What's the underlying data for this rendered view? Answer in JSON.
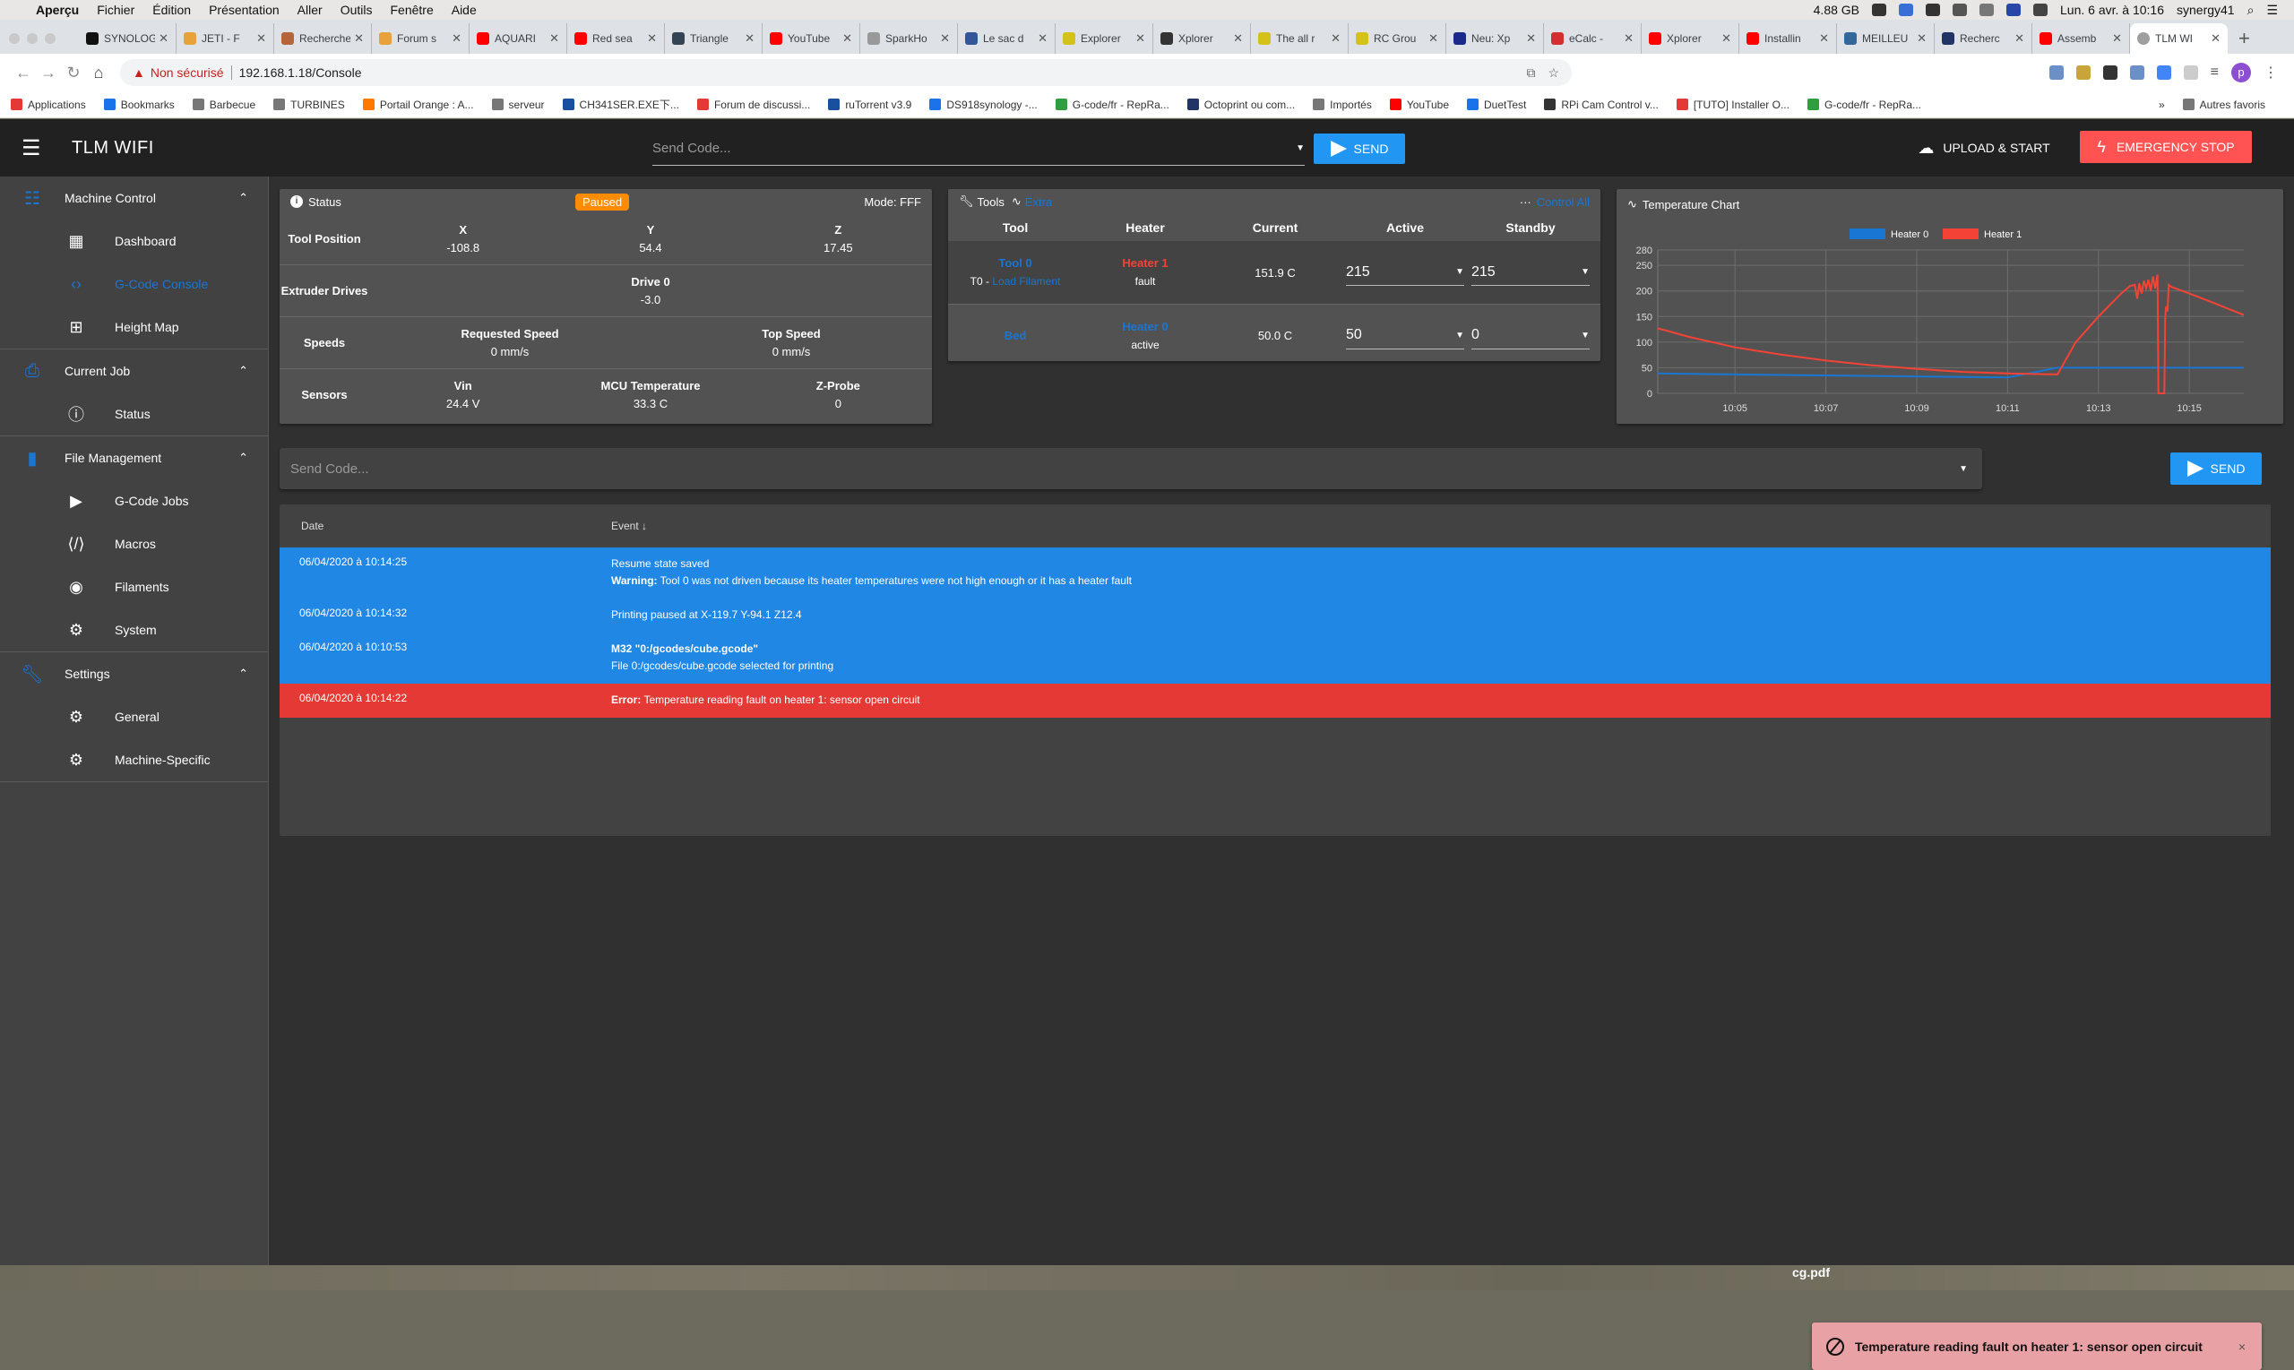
{
  "menubar": {
    "app": "Aperçu",
    "items": [
      "Fichier",
      "Édition",
      "Présentation",
      "Aller",
      "Outils",
      "Fenêtre",
      "Aide"
    ],
    "memory": "4.88 GB",
    "datetime": "Lun. 6 avr. à 10:16",
    "user": "synergy41"
  },
  "browser": {
    "tabs": [
      {
        "title": "SYNOLOGY",
        "color": "#111111"
      },
      {
        "title": "JETI - F",
        "color": "#e8a23a"
      },
      {
        "title": "Recherche",
        "color": "#b5653a"
      },
      {
        "title": "Forum s",
        "color": "#e8a23a"
      },
      {
        "title": "AQUARI",
        "color": "#ff0000"
      },
      {
        "title": "Red sea",
        "color": "#ff0000"
      },
      {
        "title": "Triangle",
        "color": "#334455"
      },
      {
        "title": "YouTube",
        "color": "#ff0000"
      },
      {
        "title": "SparkHo",
        "color": "#999999"
      },
      {
        "title": "Le sac d",
        "color": "#335599"
      },
      {
        "title": "Explorer",
        "color": "#d4c21a"
      },
      {
        "title": "Xplorer",
        "color": "#333333"
      },
      {
        "title": "The all r",
        "color": "#d4c21a"
      },
      {
        "title": "RC Grou",
        "color": "#d4c21a"
      },
      {
        "title": "Neu: Xp",
        "color": "#1a2a8a"
      },
      {
        "title": "eCalc -",
        "color": "#d32f2f"
      },
      {
        "title": "Xplorer",
        "color": "#ff0000"
      },
      {
        "title": "Installin",
        "color": "#ff0000"
      },
      {
        "title": "MEILLEU",
        "color": "#336699"
      },
      {
        "title": "Recherc",
        "color": "#223366"
      },
      {
        "title": "Assemb",
        "color": "#ff0000"
      },
      {
        "title": "TLM WI",
        "color": "#9e9e9e",
        "active": true
      }
    ],
    "new_tab": "+",
    "security_label": "Non sécurisé",
    "url": "192.168.1.18/Console",
    "profile_initial": "p",
    "bookmarks": [
      {
        "label": "Applications",
        "color": "#e53935"
      },
      {
        "label": "Bookmarks",
        "color": "#1a73e8"
      },
      {
        "label": "Barbecue",
        "color": "#777777"
      },
      {
        "label": "TURBINES",
        "color": "#777777"
      },
      {
        "label": "Portail Orange : A...",
        "color": "#ff7900"
      },
      {
        "label": "serveur",
        "color": "#777777"
      },
      {
        "label": "CH341SER.EXE下...",
        "color": "#1a4fa0"
      },
      {
        "label": "Forum de discussi...",
        "color": "#e53935"
      },
      {
        "label": "ruTorrent v3.9",
        "color": "#1a4fa0"
      },
      {
        "label": "DS918synology -...",
        "color": "#1a73e8"
      },
      {
        "label": "G-code/fr - RepRa...",
        "color": "#2e9e3e"
      },
      {
        "label": "Octoprint ou com...",
        "color": "#223366"
      },
      {
        "label": "Importés",
        "color": "#777777"
      },
      {
        "label": "YouTube",
        "color": "#ff0000"
      },
      {
        "label": "DuetTest",
        "color": "#1a73e8"
      },
      {
        "label": "RPi Cam Control v...",
        "color": "#333333"
      },
      {
        "label": "[TUTO] Installer O...",
        "color": "#e53935"
      },
      {
        "label": "G-code/fr - RepRa...",
        "color": "#2e9e3e"
      }
    ],
    "more_bookmarks": "»",
    "other_bookmarks": "Autres favoris"
  },
  "app": {
    "title": "TLM WIFI",
    "top_code_placeholder": "Send Code...",
    "send_label": "SEND",
    "upload_label": "UPLOAD & START",
    "estop_label": "EMERGENCY STOP",
    "colors": {
      "accent": "#2196f3",
      "primary": "#1976d2",
      "danger": "#ff5252",
      "paused": "#ff8c00"
    }
  },
  "sidebar": {
    "groups": [
      {
        "label": "Machine Control",
        "icon": "tune-icon",
        "items": [
          {
            "label": "Dashboard",
            "icon": "dashboard-icon"
          },
          {
            "label": "G-Code Console",
            "icon": "code-icon",
            "active": true
          },
          {
            "label": "Height Map",
            "icon": "grid-icon"
          }
        ]
      },
      {
        "label": "Current Job",
        "icon": "printer-icon",
        "items": [
          {
            "label": "Status",
            "icon": "info-icon"
          }
        ]
      },
      {
        "label": "File Management",
        "icon": "sd-card-icon",
        "items": [
          {
            "label": "G-Code Jobs",
            "icon": "play-icon"
          },
          {
            "label": "Macros",
            "icon": "code-braces-icon"
          },
          {
            "label": "Filaments",
            "icon": "radio-button-icon"
          },
          {
            "label": "System",
            "icon": "gear-icon"
          }
        ]
      },
      {
        "label": "Settings",
        "icon": "wrench-icon",
        "items": [
          {
            "label": "General",
            "icon": "gear-icon"
          },
          {
            "label": "Machine-Specific",
            "icon": "settings-box-icon"
          }
        ]
      }
    ]
  },
  "status": {
    "title": "Status",
    "state": "Paused",
    "mode": "Mode: FFF",
    "rows": [
      {
        "label": "Tool Position",
        "cols": [
          {
            "h": "X",
            "v": "-108.8"
          },
          {
            "h": "Y",
            "v": "54.4"
          },
          {
            "h": "Z",
            "v": "17.45"
          }
        ]
      },
      {
        "label": "Extruder Drives",
        "cols": [
          {
            "h": "Drive 0",
            "v": "-3.0"
          }
        ]
      },
      {
        "label": "Speeds",
        "cols": [
          {
            "h": "Requested Speed",
            "v": "0 mm/s"
          },
          {
            "h": "Top Speed",
            "v": "0 mm/s"
          }
        ]
      },
      {
        "label": "Sensors",
        "cols": [
          {
            "h": "Vin",
            "v": "24.4 V"
          },
          {
            "h": "MCU Temperature",
            "v": "33.3 C"
          },
          {
            "h": "Z-Probe",
            "v": "0"
          }
        ]
      }
    ]
  },
  "tools": {
    "title": "Tools",
    "extra": "Extra",
    "control_all": "Control All",
    "headers": [
      "Tool",
      "Heater",
      "Current",
      "Active",
      "Standby"
    ],
    "rows": [
      {
        "tool": "Tool 0",
        "sub_prefix": "T0 - ",
        "sub_link": "Load Filament",
        "heater": "Heater 1",
        "heater_state": "fault",
        "current": "151.9 C",
        "active": "215",
        "standby": "215"
      },
      {
        "tool": "Bed",
        "sub_prefix": "",
        "sub_link": "",
        "heater": "Heater 0",
        "heater_state": "active",
        "current": "50.0 C",
        "active": "50",
        "standby": "0"
      }
    ]
  },
  "console": {
    "placeholder": "Send Code...",
    "send_label": "SEND",
    "headers": {
      "date": "Date",
      "event": "Event ↓"
    },
    "entries": [
      {
        "type": "info",
        "date": "06/04/2020 à 10:14:25",
        "lines": [
          {
            "bold": "",
            "text": "Resume state saved"
          },
          {
            "bold": "Warning:",
            "text": " Tool 0 was not driven because its heater temperatures were not high enough or it has a heater fault"
          }
        ]
      },
      {
        "type": "info",
        "date": "06/04/2020 à 10:14:32",
        "lines": [
          {
            "bold": "",
            "text": "Printing paused at X-119.7 Y-94.1 Z12.4"
          }
        ]
      },
      {
        "type": "info",
        "date": "06/04/2020 à 10:10:53",
        "lines": [
          {
            "bold": "M32 \"0:/gcodes/cube.gcode\"",
            "text": ""
          },
          {
            "bold": "",
            "text": "File 0:/gcodes/cube.gcode selected for printing"
          }
        ]
      },
      {
        "type": "err",
        "date": "06/04/2020 à 10:14:22",
        "lines": [
          {
            "bold": "Error:",
            "text": " Temperature reading fault on heater 1: sensor open circuit"
          }
        ]
      }
    ]
  },
  "toast": {
    "message": "Temperature reading fault on heater 1: sensor open circuit",
    "close": "×"
  },
  "dock": {
    "file": "cg.pdf"
  },
  "chart_data": {
    "type": "line",
    "title": "Temperature Chart",
    "xlabel": "",
    "ylabel": "",
    "x_unit": "minutes after 10:00",
    "xlim": [
      3.3,
      16.2
    ],
    "ylim": [
      0,
      280
    ],
    "yticks": [
      0,
      50,
      100,
      150,
      200,
      250,
      280
    ],
    "xticks": [
      {
        "v": 5,
        "label": "10:05"
      },
      {
        "v": 7,
        "label": "10:07"
      },
      {
        "v": 9,
        "label": "10:09"
      },
      {
        "v": 11,
        "label": "10:11"
      },
      {
        "v": 13,
        "label": "10:13"
      },
      {
        "v": 15,
        "label": "10:15"
      }
    ],
    "grid": true,
    "legend": "top-center",
    "series": [
      {
        "name": "Heater 0",
        "color": "#1976d2",
        "x": [
          3.3,
          5,
          7,
          9,
          11,
          12.1,
          13,
          14,
          15,
          16.2
        ],
        "y": [
          39,
          37,
          35,
          33,
          31,
          50,
          50,
          50,
          50,
          50
        ]
      },
      {
        "name": "Heater 1",
        "color": "#f44336",
        "x": [
          3.3,
          4,
          5,
          6,
          7,
          8,
          9,
          10,
          11,
          12.1,
          12.5,
          13,
          13.5,
          13.7,
          13.8,
          13.85,
          13.9,
          13.95,
          14.0,
          14.05,
          14.1,
          14.15,
          14.2,
          14.25,
          14.3,
          14.32,
          14.34,
          14.36,
          14.45,
          14.47,
          14.49,
          14.52,
          14.55,
          14.6,
          15,
          15.5,
          16.2
        ],
        "y": [
          127,
          110,
          90,
          76,
          64,
          55,
          48,
          42,
          39,
          37,
          100,
          150,
          195,
          210,
          212,
          185,
          215,
          195,
          220,
          205,
          222,
          200,
          228,
          205,
          232,
          0,
          0,
          0,
          0,
          150,
          170,
          160,
          212,
          208,
          195,
          178,
          153
        ]
      }
    ]
  }
}
